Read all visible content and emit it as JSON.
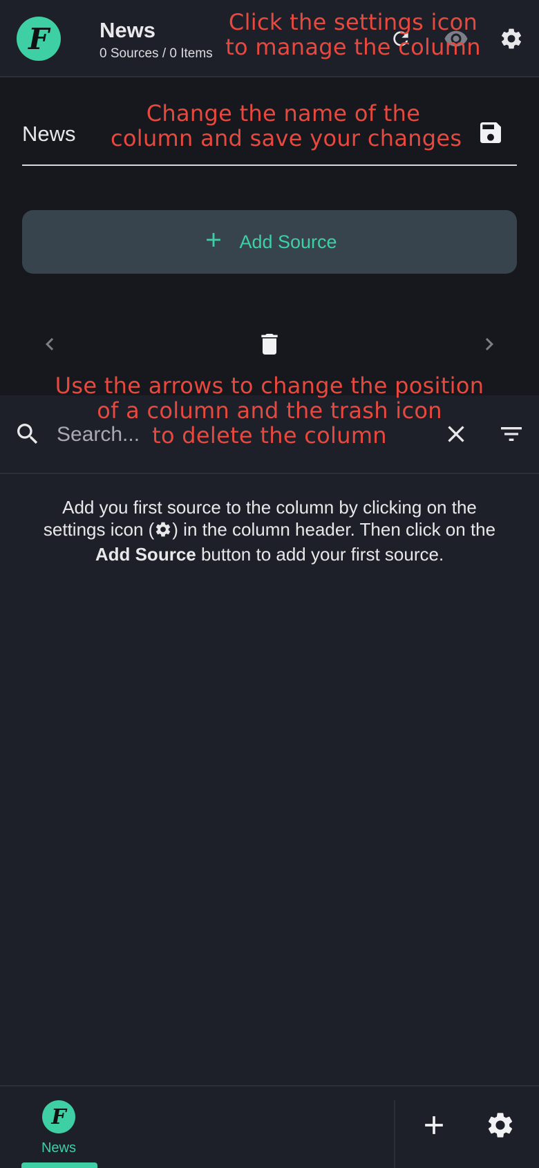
{
  "header": {
    "logo_letter": "F",
    "column_title": "News",
    "column_subtitle": "0 Sources / 0 Items",
    "icons": [
      "refresh-icon",
      "eye-icon",
      "gear-icon"
    ]
  },
  "settings": {
    "name_value": "News",
    "add_source_label": "Add Source",
    "icons": [
      "save-icon",
      "chevron-left-icon",
      "trash-icon",
      "chevron-right-icon"
    ]
  },
  "search": {
    "placeholder": "Search...",
    "icons": [
      "search-icon",
      "close-icon",
      "filter-icon"
    ]
  },
  "empty_state": {
    "line1": "Add you first source to the column by clicking on the",
    "line2_prefix": "settings icon (",
    "line2_suffix": ") in the column header. Then click on the",
    "line3_bold": "Add Source",
    "line3_suffix": " button to add your first source."
  },
  "annotations": {
    "settings_hint_1": "Click the settings icon",
    "settings_hint_2": "to manage the column",
    "name_hint_1": "Change the name of the",
    "name_hint_2": "column and save your changes",
    "arrows_hint_1": "Use the arrows to change the position",
    "arrows_hint_2": "of a column and the trash icon",
    "arrows_hint_3": "to delete the column"
  },
  "bottom_nav": {
    "avatar_letter": "F",
    "item_label": "News",
    "icons": [
      "plus-icon",
      "gear-icon"
    ]
  },
  "colors": {
    "accent": "#3fcfa5",
    "annotation": "#e8493f",
    "background": "#1e2029",
    "panel": "#17181d",
    "button": "#37444d"
  }
}
